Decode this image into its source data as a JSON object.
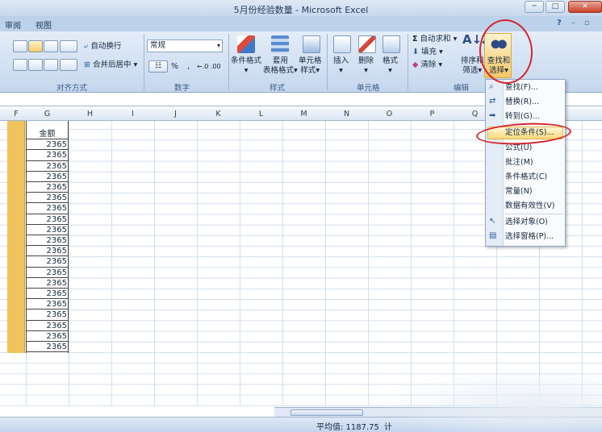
{
  "window": {
    "title": "5月份经验数量 - Microsoft Excel",
    "min": "─",
    "max": "□",
    "close": "✕"
  },
  "tabs": [
    "审阅",
    "视图"
  ],
  "help_icon": "?",
  "ribbon": {
    "align_group": {
      "label": "对齐方式",
      "wrap": "自动换行",
      "merge": "合并后居中"
    },
    "number_group": {
      "label": "数字",
      "format": "常规",
      "percent": "%",
      "comma": ",",
      "decimals": "←.0 .00"
    },
    "style_group": {
      "label": "样式",
      "cond_format": "条件格式",
      "table_format_l1": "套用",
      "table_format_l2": "表格格式",
      "cell_style_l1": "单元格",
      "cell_style_l2": "样式"
    },
    "cells_group": {
      "label": "单元格",
      "insert": "插入",
      "delete": "删除",
      "format": "格式"
    },
    "edit_group": {
      "label": "编辑",
      "autosum": "自动求和",
      "fill": "填充",
      "clear": "清除",
      "sort_l1": "排序和",
      "sort_l2": "筛选",
      "find_l1": "查找和",
      "find_l2": "选择"
    }
  },
  "columns": [
    "F",
    "G",
    "H",
    "I",
    "J",
    "K",
    "L",
    "M",
    "N",
    "O",
    "P",
    "Q"
  ],
  "sheet": {
    "header": "金额",
    "values": [
      "2365",
      "2365",
      "2365",
      "2365",
      "2365",
      "2365",
      "2365",
      "2365",
      "2365",
      "2365",
      "2365",
      "2365",
      "2365",
      "2365",
      "2365",
      "2365",
      "2365",
      "2365",
      "2365",
      "2365"
    ]
  },
  "menu": [
    {
      "label": "查找(F)...",
      "icon": "⌕"
    },
    {
      "label": "替换(R)...",
      "icon": "⇄"
    },
    {
      "label": "转到(G)...",
      "icon": "➡"
    },
    {
      "label": "定位条件(S)...",
      "icon": ""
    },
    {
      "label": "公式(U)",
      "icon": ""
    },
    {
      "label": "批注(M)",
      "icon": ""
    },
    {
      "label": "条件格式(C)",
      "icon": ""
    },
    {
      "label": "常量(N)",
      "icon": ""
    },
    {
      "label": "数据有效性(V)",
      "icon": ""
    },
    {
      "label": "选择对象(O)",
      "icon": "↖"
    },
    {
      "label": "选择窗格(P)...",
      "icon": "▤"
    }
  ],
  "status": {
    "average": "平均值: 1187.75",
    "count_partial": "计"
  }
}
